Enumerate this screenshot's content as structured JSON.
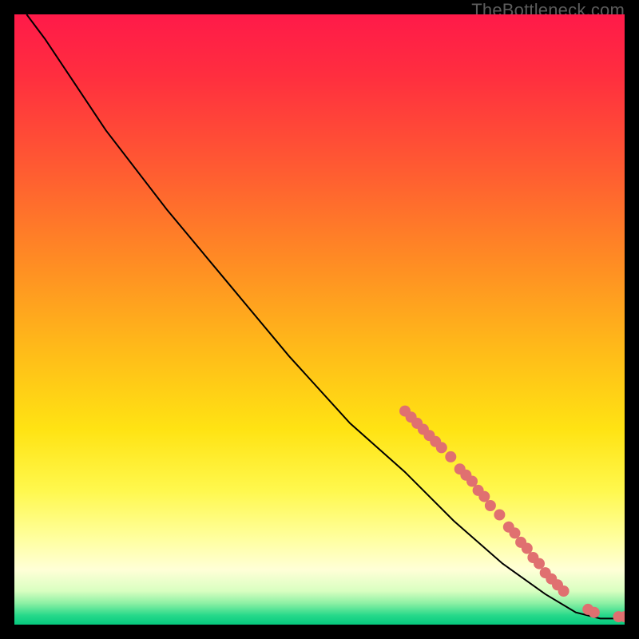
{
  "watermark": "TheBottleneck.com",
  "chart_data": {
    "type": "line",
    "title": "",
    "xlabel": "",
    "ylabel": "",
    "xlim": [
      0,
      100
    ],
    "ylim": [
      0,
      100
    ],
    "curve": [
      {
        "x": 2,
        "y": 100
      },
      {
        "x": 5,
        "y": 96
      },
      {
        "x": 9,
        "y": 90
      },
      {
        "x": 15,
        "y": 81
      },
      {
        "x": 25,
        "y": 68
      },
      {
        "x": 35,
        "y": 56
      },
      {
        "x": 45,
        "y": 44
      },
      {
        "x": 55,
        "y": 33
      },
      {
        "x": 64,
        "y": 25
      },
      {
        "x": 72,
        "y": 17
      },
      {
        "x": 80,
        "y": 10
      },
      {
        "x": 87,
        "y": 5
      },
      {
        "x": 92,
        "y": 2
      },
      {
        "x": 96,
        "y": 1
      },
      {
        "x": 100,
        "y": 1
      }
    ],
    "markers": [
      {
        "x": 64,
        "y": 35
      },
      {
        "x": 65,
        "y": 34
      },
      {
        "x": 66,
        "y": 33
      },
      {
        "x": 67,
        "y": 32
      },
      {
        "x": 68,
        "y": 31
      },
      {
        "x": 69,
        "y": 30
      },
      {
        "x": 70,
        "y": 29
      },
      {
        "x": 71.5,
        "y": 27.5
      },
      {
        "x": 73,
        "y": 25.5
      },
      {
        "x": 74,
        "y": 24.5
      },
      {
        "x": 75,
        "y": 23.5
      },
      {
        "x": 76,
        "y": 22
      },
      {
        "x": 77,
        "y": 21
      },
      {
        "x": 78,
        "y": 19.5
      },
      {
        "x": 79.5,
        "y": 18
      },
      {
        "x": 81,
        "y": 16
      },
      {
        "x": 82,
        "y": 15
      },
      {
        "x": 83,
        "y": 13.5
      },
      {
        "x": 84,
        "y": 12.5
      },
      {
        "x": 85,
        "y": 11
      },
      {
        "x": 86,
        "y": 10
      },
      {
        "x": 87,
        "y": 8.5
      },
      {
        "x": 88,
        "y": 7.5
      },
      {
        "x": 89,
        "y": 6.5
      },
      {
        "x": 90,
        "y": 5.5
      },
      {
        "x": 94,
        "y": 2.5
      },
      {
        "x": 95,
        "y": 2
      },
      {
        "x": 99,
        "y": 1.3
      },
      {
        "x": 100,
        "y": 1.3
      }
    ],
    "marker_radius": 7,
    "marker_color": "#e07070",
    "curve_color": "#000000",
    "gradient_stops": [
      {
        "offset": 0.0,
        "color": "#ff1a49"
      },
      {
        "offset": 0.1,
        "color": "#ff2e3f"
      },
      {
        "offset": 0.25,
        "color": "#ff5a32"
      },
      {
        "offset": 0.4,
        "color": "#ff8a24"
      },
      {
        "offset": 0.55,
        "color": "#ffbb19"
      },
      {
        "offset": 0.68,
        "color": "#ffe313"
      },
      {
        "offset": 0.78,
        "color": "#fff84d"
      },
      {
        "offset": 0.86,
        "color": "#ffffa0"
      },
      {
        "offset": 0.91,
        "color": "#ffffd7"
      },
      {
        "offset": 0.945,
        "color": "#d9ffc1"
      },
      {
        "offset": 0.965,
        "color": "#8cf0a4"
      },
      {
        "offset": 0.985,
        "color": "#26d98a"
      },
      {
        "offset": 1.0,
        "color": "#06c97f"
      }
    ]
  }
}
